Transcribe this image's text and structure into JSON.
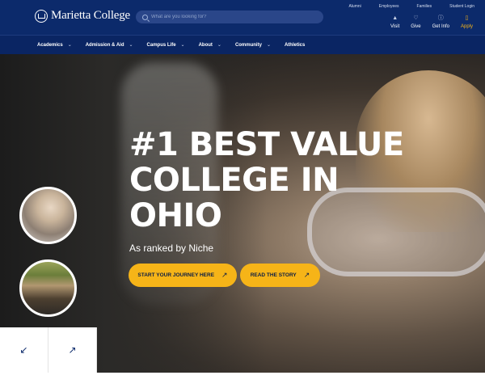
{
  "header": {
    "logo_text": "Marietta College",
    "search_placeholder": "What are you looking for?",
    "utility_links": [
      "Alumni",
      "Employees",
      "Families",
      "Student Login"
    ],
    "quick_links": [
      {
        "label": "Visit",
        "icon": "map-pin-icon"
      },
      {
        "label": "Give",
        "icon": "heart-icon"
      },
      {
        "label": "Get Info",
        "icon": "info-icon"
      },
      {
        "label": "Apply",
        "icon": "document-icon"
      }
    ],
    "nav": [
      {
        "label": "Academics",
        "has_dropdown": true
      },
      {
        "label": "Admission & Aid",
        "has_dropdown": true
      },
      {
        "label": "Campus Life",
        "has_dropdown": true
      },
      {
        "label": "About",
        "has_dropdown": true
      },
      {
        "label": "Community",
        "has_dropdown": true
      },
      {
        "label": "Athletics",
        "has_dropdown": false
      }
    ]
  },
  "hero": {
    "headline": "#1 BEST VALUE COLLEGE IN OHIO",
    "subtext": "As ranked by Niche",
    "buttons": [
      {
        "label": "START YOUR JOURNEY HERE",
        "icon": "arrow-up-right-icon"
      },
      {
        "label": "READ THE STORY",
        "icon": "arrow-up-right-icon"
      }
    ]
  },
  "colors": {
    "navy": "#0c2a6b",
    "gold": "#f6b418"
  }
}
